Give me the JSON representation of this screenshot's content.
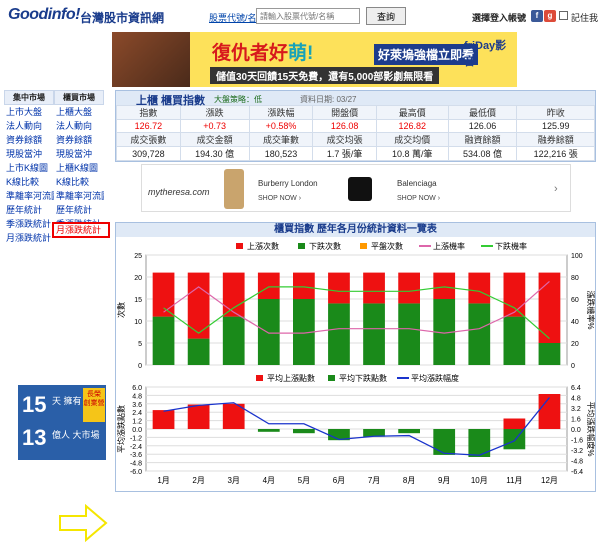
{
  "header": {
    "logo": "Goodinfo!",
    "site_name": "台灣股市資訊網",
    "symbol_label": "股票代號/名稱",
    "search_placeholder": "請輸入股票代號/名稱",
    "search_button": "查詢",
    "login_text": "選擇登入帳號",
    "social_icons": [
      "facebook-icon",
      "google-icon"
    ],
    "remember_label": "記住我"
  },
  "ad_top": {
    "line1a": "復仇者好",
    "line1b": "萌!",
    "line2": "好萊塢強檔立即看",
    "line3": "儲值30天回饋15天免費，還有5,000部影劇無限看",
    "brand": "friDay影音"
  },
  "sidebar": {
    "headers": [
      "集中市場",
      "櫃買市場"
    ],
    "rows": [
      [
        "上市大盤",
        "上櫃大盤"
      ],
      [
        "法人動向",
        "法人動向"
      ],
      [
        "資券餘額",
        "資券餘額"
      ],
      [
        "現股當沖",
        "現股當沖"
      ],
      [
        "上市K線圖",
        "上櫃K線圖"
      ],
      [
        "K線比較",
        "K線比較"
      ],
      [
        "準離率河流圖",
        "準離率河流圖"
      ],
      [
        "歷年統計",
        "歷年統計"
      ],
      [
        "季漲跌統計",
        "季漲跌統計"
      ],
      [
        "月漲跌統計",
        ""
      ]
    ],
    "highlighted": "月漲跌統計"
  },
  "side_ad": {
    "big1": "15",
    "t1": "天 擁有",
    "big2": "13",
    "t2": "億人 大市場",
    "gold": "長榮 創業營"
  },
  "quote": {
    "title": "上櫃  櫃買指數",
    "status": "大盤策略：低",
    "date": "資料日期: 03/27",
    "row1_headers": [
      "指數",
      "漲跌",
      "漲跌幅",
      "開盤價",
      "最高價",
      "最低價",
      "昨收"
    ],
    "row1_values": [
      "126.72",
      "+0.73",
      "+0.58%",
      "126.08",
      "126.82",
      "126.06",
      "125.99"
    ],
    "row2_headers": [
      "成交張數",
      "成交金額",
      "成交筆數",
      "成交均張",
      "成交均價",
      "融資餘額",
      "融券餘額"
    ],
    "row2_values": [
      "309,728",
      "194.30 億",
      "180,523",
      "1.7 張/筆",
      "10.8 萬/筆",
      "534.08 億",
      "122,216 張"
    ]
  },
  "ad_banner": {
    "brand": "mytheresa.com",
    "b1": "Burberry London",
    "b2": "Balenciaga",
    "shop": "SHOP NOW ›",
    "arrow": "›"
  },
  "chart": {
    "title": "櫃買指數 歷年各月份統計資料一覽表",
    "months": [
      "1月",
      "2月",
      "3月",
      "4月",
      "5月",
      "6月",
      "7月",
      "8月",
      "9月",
      "10月",
      "11月",
      "12月"
    ],
    "top_legend": [
      "上漲次數",
      "下跌次數",
      "平盤次數",
      "上漲機率",
      "下跌機率"
    ],
    "top_left_label": "次數",
    "top_right_label": "漲跌機率%",
    "bottom_legend": [
      "平均上漲點數",
      "平均下跌點數",
      "平均漲跌幅度"
    ],
    "bottom_left_label": "平均漲跌點數",
    "bottom_right_label": "平均漲跌幅度%",
    "colors": {
      "up": "#ee1111",
      "down": "#1a8a1a",
      "flat": "#ff9900",
      "up_prob": "#dd66aa",
      "down_prob": "#33cc33",
      "avg": "#1a33cc"
    }
  },
  "chart_data": [
    {
      "type": "bar",
      "title": "",
      "categories": [
        "1月",
        "2月",
        "3月",
        "4月",
        "5月",
        "6月",
        "7月",
        "8月",
        "9月",
        "10月",
        "11月",
        "12月"
      ],
      "series": [
        {
          "name": "上漲次數",
          "values": [
            10,
            15,
            10,
            6,
            6,
            7,
            7,
            7,
            6,
            7,
            10,
            16
          ]
        },
        {
          "name": "下跌次數",
          "values": [
            11,
            6,
            11,
            15,
            15,
            14,
            14,
            14,
            15,
            14,
            11,
            5
          ]
        },
        {
          "name": "平盤次數",
          "values": [
            0,
            0,
            0,
            0,
            0,
            0,
            0,
            0,
            0,
            0,
            0,
            0
          ]
        },
        {
          "name": "上漲機率",
          "values": [
            48,
            71,
            48,
            29,
            29,
            33,
            33,
            33,
            29,
            33,
            48,
            76
          ]
        },
        {
          "name": "下跌機率",
          "values": [
            52,
            29,
            52,
            71,
            71,
            67,
            67,
            67,
            71,
            67,
            52,
            24
          ]
        }
      ],
      "ylim_left": [
        0,
        25
      ],
      "yticks_left": [
        0,
        5,
        10,
        15,
        20,
        25
      ],
      "ylim_right": [
        0,
        100
      ],
      "yticks_right": [
        0,
        20,
        40,
        60,
        80,
        100
      ]
    },
    {
      "type": "bar",
      "title": "",
      "categories": [
        "1月",
        "2月",
        "3月",
        "4月",
        "5月",
        "6月",
        "7月",
        "8月",
        "9月",
        "10月",
        "11月",
        "12月"
      ],
      "series": [
        {
          "name": "平均上漲點數",
          "values": [
            2.7,
            3.5,
            3.6,
            0,
            0,
            0,
            0,
            0,
            0,
            0,
            1.5,
            5.0
          ]
        },
        {
          "name": "平均下跌點數",
          "values": [
            0,
            0,
            0,
            -0.4,
            -0.6,
            -1.6,
            -1.1,
            -0.6,
            -3.7,
            -4.0,
            -2.9,
            0
          ]
        },
        {
          "name": "平均漲跌幅度",
          "values": [
            2.7,
            3.6,
            4.0,
            0.8,
            0.8,
            -1.6,
            -1.1,
            -1.0,
            -3.7,
            -4.0,
            -1.8,
            4.8
          ]
        }
      ],
      "ylim_left": [
        -6,
        6
      ],
      "yticks_left": [
        -6,
        -4.8,
        -3.6,
        -2.4,
        -1.2,
        0,
        1.2,
        2.4,
        3.6,
        4.8,
        6
      ],
      "ylim_right": [
        -6.4,
        6.4
      ],
      "yticks_right": [
        -6.4,
        -4.8,
        -3.2,
        -1.6,
        0,
        1.6,
        3.2,
        4.8,
        6.4
      ]
    }
  ]
}
